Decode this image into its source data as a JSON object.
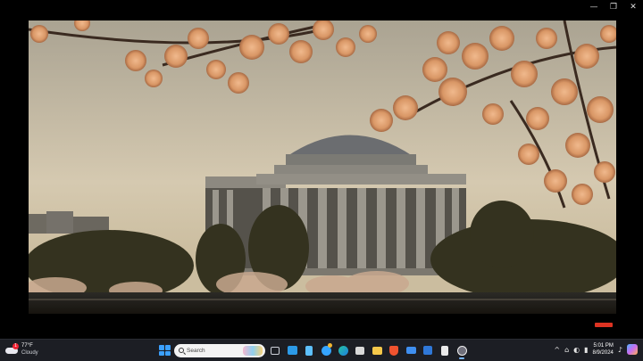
{
  "window": {
    "controls": {
      "minimize": "—",
      "maximize": "❐",
      "close": "✕"
    }
  },
  "video": {
    "scene": "cherry-blossoms-and-domed-memorial-at-sunrise",
    "colors": {
      "sky_top": "#b3ab9c",
      "sky_bottom": "#d7ccb4",
      "blossom": "#e2a67a",
      "building": "#7a766f"
    }
  },
  "taskbar": {
    "weather": {
      "temp": "77°F",
      "condition": "Cloudy",
      "badge": "1",
      "icon": "cloud-icon"
    },
    "search": {
      "placeholder": "Search"
    },
    "apps": [
      {
        "name": "task-view-icon",
        "color": "#ccd0d8"
      },
      {
        "name": "widgets-icon",
        "color": "#2c9be8"
      },
      {
        "name": "notepad-icon",
        "color": "#5dc0ff"
      },
      {
        "name": "store-icon",
        "color": "#35a4ff"
      },
      {
        "name": "edge-icon",
        "color": "#23c4a0"
      },
      {
        "name": "media-icon",
        "color": "#d9d9d9"
      },
      {
        "name": "explorer-icon",
        "color": "#f5c84a"
      },
      {
        "name": "brave-icon",
        "color": "#f0532f"
      },
      {
        "name": "mail-icon",
        "color": "#3f8ff0"
      },
      {
        "name": "calendar-icon",
        "color": "#2f78d8"
      },
      {
        "name": "documents-icon",
        "color": "#eaeaea"
      },
      {
        "name": "video-player-icon",
        "color": "#6f6f7a"
      }
    ],
    "tray": {
      "time": "5:01 PM",
      "date": "8/9/2024",
      "icons": [
        "^",
        "⌂",
        "◐",
        "▮"
      ]
    }
  }
}
